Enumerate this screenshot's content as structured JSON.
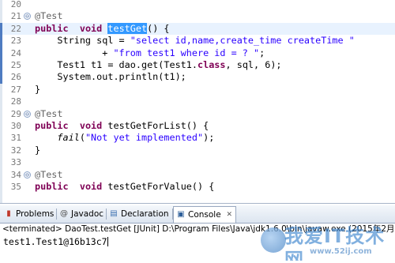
{
  "editor": {
    "lines": [
      {
        "n": "20",
        "segs": []
      },
      {
        "n": "21",
        "marker": "⊖",
        "segs": [
          [
            "ann",
            "@Test"
          ]
        ]
      },
      {
        "n": "22",
        "segs": [
          [
            "kw",
            "public"
          ],
          [
            "",
            "  "
          ],
          [
            "kw",
            "void"
          ],
          [
            "",
            " "
          ],
          [
            "sel",
            "testGet"
          ],
          [
            "",
            "() {"
          ]
        ]
      },
      {
        "n": "23",
        "segs": [
          [
            "",
            "    String sql = "
          ],
          [
            "str",
            "\"select id,name,create_time createTime \""
          ]
        ]
      },
      {
        "n": "24",
        "segs": [
          [
            "",
            "            + "
          ],
          [
            "str",
            "\"from test1 where id = ? \""
          ],
          [
            "",
            ";"
          ]
        ]
      },
      {
        "n": "25",
        "segs": [
          [
            "",
            "    Test1 t1 = "
          ],
          [
            "",
            "dao"
          ],
          [
            "",
            ".get(Test1."
          ],
          [
            "kw",
            "class"
          ],
          [
            "",
            ", sql, 6);"
          ]
        ]
      },
      {
        "n": "26",
        "segs": [
          [
            "",
            "    System."
          ],
          [
            "",
            "out"
          ],
          [
            "",
            ".println(t1);"
          ]
        ]
      },
      {
        "n": "27",
        "segs": [
          [
            "",
            "}"
          ]
        ]
      },
      {
        "n": "28",
        "segs": []
      },
      {
        "n": "29",
        "marker": "⊖",
        "segs": [
          [
            "ann",
            "@Test"
          ]
        ]
      },
      {
        "n": "30",
        "segs": [
          [
            "kw",
            "public"
          ],
          [
            "",
            "  "
          ],
          [
            "kw",
            "void"
          ],
          [
            "",
            " testGetForList() {"
          ]
        ]
      },
      {
        "n": "31",
        "segs": [
          [
            "",
            "    "
          ],
          [
            "ital",
            "fail"
          ],
          [
            "",
            "("
          ],
          [
            "str",
            "\"Not yet implemented\""
          ],
          [
            "",
            ");"
          ]
        ]
      },
      {
        "n": "32",
        "segs": [
          [
            "",
            "}"
          ]
        ]
      },
      {
        "n": "33",
        "segs": []
      },
      {
        "n": "34",
        "marker": "⊖",
        "segs": [
          [
            "ann",
            "@Test"
          ]
        ]
      },
      {
        "n": "35",
        "segs": [
          [
            "kw",
            "public"
          ],
          [
            "",
            "  "
          ],
          [
            "kw",
            "void"
          ],
          [
            "",
            " testGetForValue() {"
          ]
        ]
      }
    ]
  },
  "console_view": {
    "tabs": [
      {
        "label": "Problems",
        "icon": "problems-icon",
        "glyph": "▮",
        "color": "#c0392b"
      },
      {
        "label": "Javadoc",
        "icon": "javadoc-icon",
        "glyph": "@",
        "color": "#444444"
      },
      {
        "label": "Declaration",
        "icon": "declaration-icon",
        "glyph": "▤",
        "color": "#3a6fb0"
      },
      {
        "label": "Console",
        "icon": "console-icon",
        "glyph": "▣",
        "color": "#2d5f9a",
        "active": true
      }
    ],
    "close_glyph": "✕",
    "header": "<terminated> DaoTest.testGet [JUnit] D:\\Program Files\\Java\\jdk1.6.0\\bin\\javaw.exe (2015年2月",
    "output": "test1.Test1@16b13c7"
  },
  "watermark": {
    "text": "我爱IT技术网",
    "url": "www.52ij.com"
  }
}
